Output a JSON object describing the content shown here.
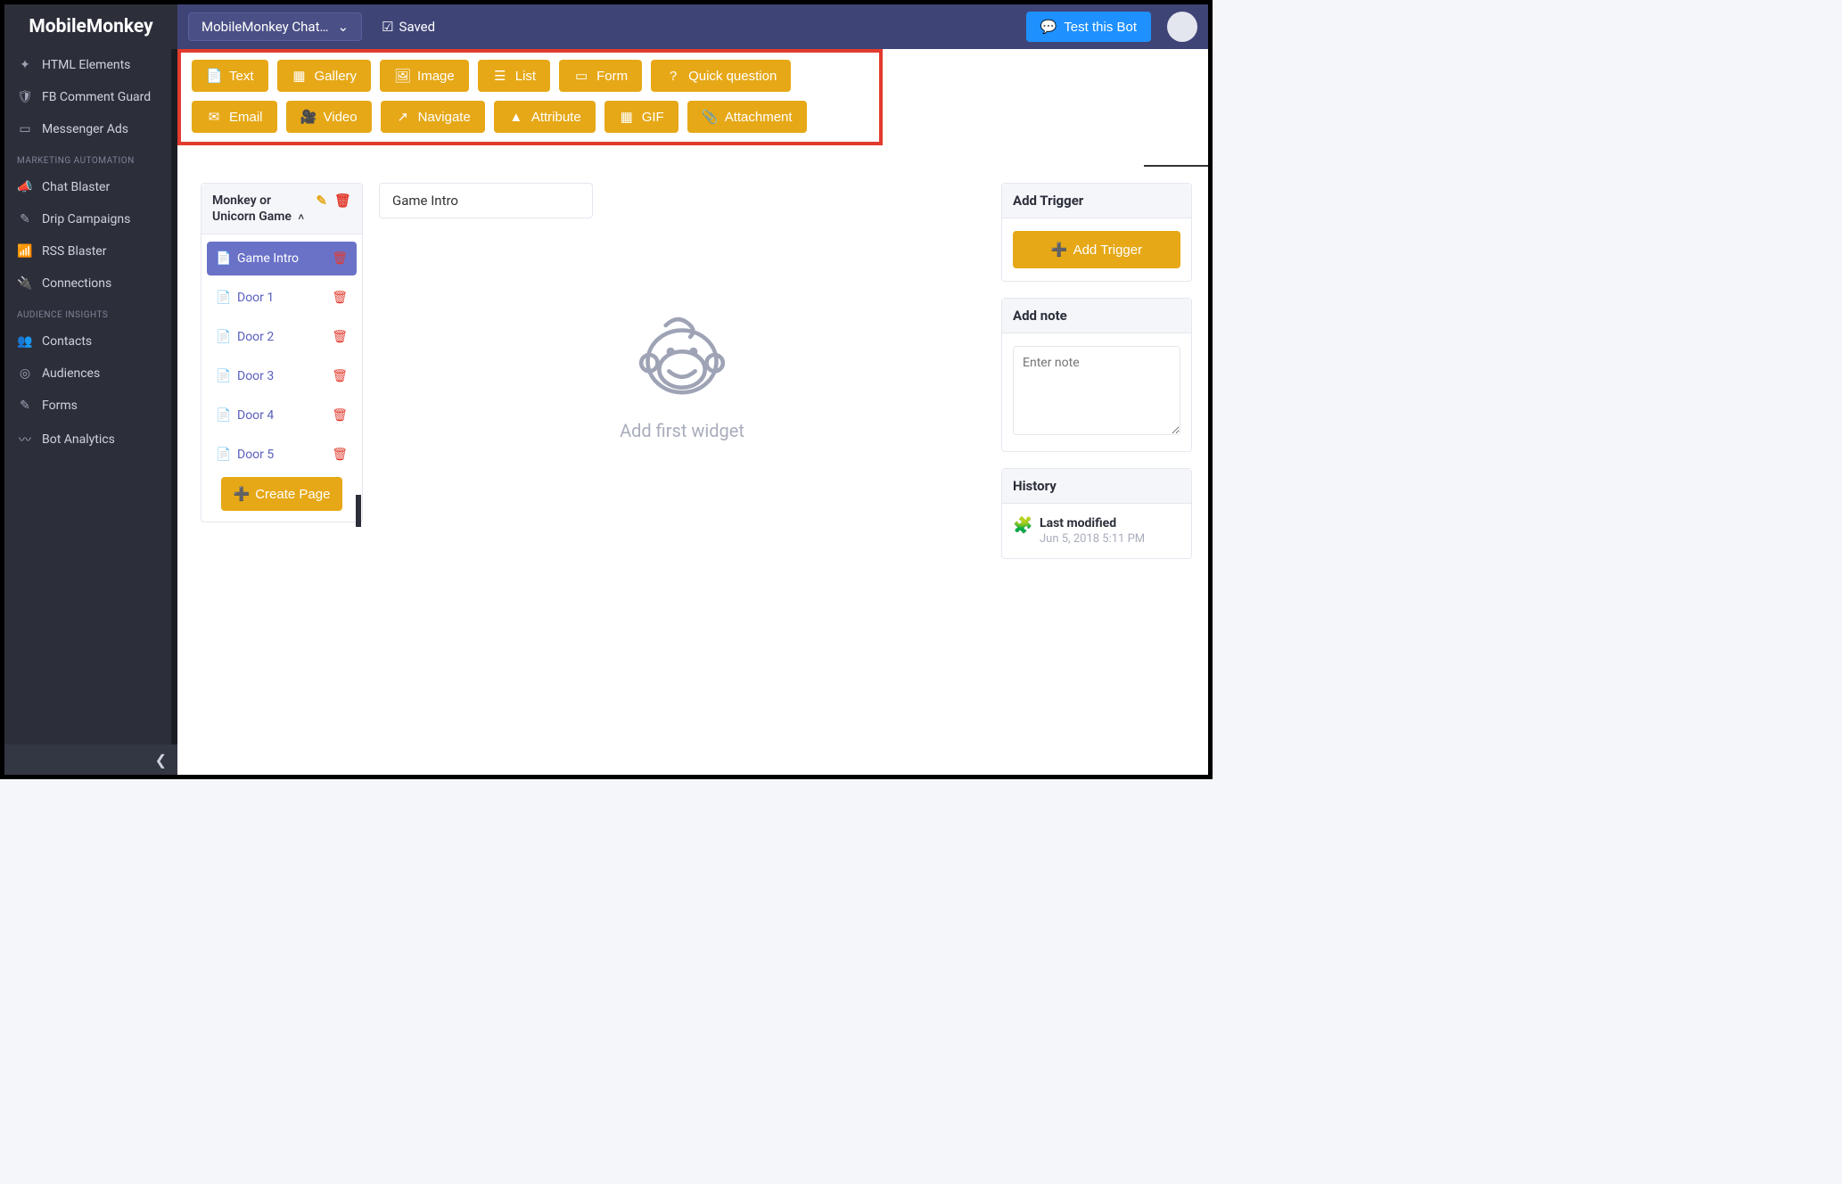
{
  "brand": "MobileMonkey",
  "topbar": {
    "bot_name": "MobileMonkey Chat…",
    "saved_label": "Saved",
    "test_bot_label": "Test this Bot"
  },
  "sidebar": {
    "items_top": [
      {
        "icon": "✦",
        "label": "HTML Elements"
      },
      {
        "icon": "🛡",
        "label": "FB Comment Guard"
      },
      {
        "icon": "▭",
        "label": "Messenger Ads"
      }
    ],
    "heading_marketing": "MARKETING AUTOMATION",
    "items_marketing": [
      {
        "icon": "📣",
        "label": "Chat Blaster"
      },
      {
        "icon": "✎",
        "label": "Drip Campaigns"
      },
      {
        "icon": "📶",
        "label": "RSS Blaster"
      },
      {
        "icon": "🔌",
        "label": "Connections"
      }
    ],
    "heading_audience": "AUDIENCE INSIGHTS",
    "items_audience": [
      {
        "icon": "👥",
        "label": "Contacts"
      },
      {
        "icon": "◎",
        "label": "Audiences"
      },
      {
        "icon": "✎",
        "label": "Forms"
      },
      {
        "icon": "〰",
        "label": "Bot Analytics"
      }
    ]
  },
  "widget_toolbar": {
    "row1": [
      {
        "icon": "📄",
        "label": "Text"
      },
      {
        "icon": "▦",
        "label": "Gallery"
      },
      {
        "icon": "🖼",
        "label": "Image"
      },
      {
        "icon": "☰",
        "label": "List"
      },
      {
        "icon": "▭",
        "label": "Form"
      },
      {
        "icon": "?",
        "label": "Quick question"
      }
    ],
    "row2": [
      {
        "icon": "✉",
        "label": "Email"
      },
      {
        "icon": "🎥",
        "label": "Video"
      },
      {
        "icon": "↗",
        "label": "Navigate"
      },
      {
        "icon": "▲",
        "label": "Attribute"
      },
      {
        "icon": "▦",
        "label": "GIF"
      },
      {
        "icon": "📎",
        "label": "Attachment"
      }
    ]
  },
  "pages_panel": {
    "group_title": "Monkey or Unicorn Game",
    "pages": [
      {
        "label": "Game Intro",
        "active": true
      },
      {
        "label": "Door 1",
        "active": false
      },
      {
        "label": "Door 2",
        "active": false
      },
      {
        "label": "Door 3",
        "active": false
      },
      {
        "label": "Door 4",
        "active": false
      },
      {
        "label": "Door 5",
        "active": false
      }
    ],
    "create_label": "Create Page"
  },
  "canvas": {
    "title": "Game Intro",
    "empty_text": "Add first widget"
  },
  "right": {
    "trigger_heading": "Add Trigger",
    "add_trigger_label": "Add Trigger",
    "note_heading": "Add note",
    "note_placeholder": "Enter note",
    "history_heading": "History",
    "history_last_modified_label": "Last modified",
    "history_last_modified_date": "Jun 5, 2018 5:11 PM"
  }
}
